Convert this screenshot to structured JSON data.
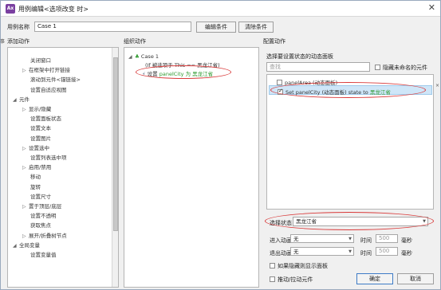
{
  "window": {
    "title": "用例编辑<选项改变 时>",
    "close": "✕",
    "app_icon": "Ax"
  },
  "top": {
    "case_name_label": "用例名称",
    "case_name_value": "Case 1",
    "edit_condition": "编辑条件",
    "clear_condition": "清除条件"
  },
  "columns": {
    "add_action": "添加动作",
    "organize_action": "组织动作",
    "configure_action": "配置动作"
  },
  "actions": [
    {
      "label": "关闭窗口",
      "indent": 2,
      "arrow": ""
    },
    {
      "label": "在框架中打开链接",
      "indent": 1,
      "arrow": "▷"
    },
    {
      "label": "滚动到元件<锚链接>",
      "indent": 2,
      "arrow": ""
    },
    {
      "label": "设置自适应视图",
      "indent": 2,
      "arrow": ""
    },
    {
      "label": "元件",
      "indent": 0,
      "arrow": "◢"
    },
    {
      "label": "显示/隐藏",
      "indent": 1,
      "arrow": "▷"
    },
    {
      "label": "设置面板状态",
      "indent": 2,
      "arrow": ""
    },
    {
      "label": "设置文本",
      "indent": 2,
      "arrow": ""
    },
    {
      "label": "设置图片",
      "indent": 2,
      "arrow": ""
    },
    {
      "label": "设置选中",
      "indent": 1,
      "arrow": "▷"
    },
    {
      "label": "设置列表选中项",
      "indent": 2,
      "arrow": ""
    },
    {
      "label": "启用/禁用",
      "indent": 1,
      "arrow": "▷"
    },
    {
      "label": "移动",
      "indent": 2,
      "arrow": ""
    },
    {
      "label": "旋转",
      "indent": 2,
      "arrow": ""
    },
    {
      "label": "设置尺寸",
      "indent": 2,
      "arrow": ""
    },
    {
      "label": "置于顶层/底层",
      "indent": 1,
      "arrow": "▷"
    },
    {
      "label": "设置不透明",
      "indent": 2,
      "arrow": ""
    },
    {
      "label": "获取焦点",
      "indent": 2,
      "arrow": ""
    },
    {
      "label": "展开/折叠树节点",
      "indent": 1,
      "arrow": "▷"
    },
    {
      "label": "全局变量",
      "indent": 0,
      "arrow": "◢"
    },
    {
      "label": "设置变量值",
      "indent": 2,
      "arrow": ""
    }
  ],
  "organize": {
    "case_label": "Case 1",
    "condition": "(If 被选项于 This == 黑龙江省)",
    "action_prefix": "设置",
    "action_target": "panelCity",
    "action_mid": "为",
    "action_value": "黑龙江省"
  },
  "configure": {
    "select_panel_label": "选择要设置状态的动态面板",
    "search_placeholder": "查找",
    "hide_unnamed": "隐藏未命名的元件",
    "panels": [
      {
        "name": "panelArea (动态面板)",
        "checked": false
      },
      {
        "prefix": "Set panelCity (动态面板) state to",
        "value": "黑龙江省",
        "checked": true
      }
    ],
    "select_state_label": "选择状态",
    "select_state_value": "黑龙江省",
    "enter_anim_label": "进入动画",
    "exit_anim_label": "退出动画",
    "anim_value": "无",
    "time_label": "时间",
    "time_value": "500",
    "ms_label": "毫秒",
    "show_if_hidden": "如果隐藏则显示面板",
    "push_pull": "推动/拉动元件"
  },
  "footer": {
    "ok": "确定",
    "cancel": "取消"
  },
  "edges": {
    "left_char": "事",
    "right_top": "×",
    "right_mid": "S..."
  },
  "colors": {
    "accent_green": "#2f9a2f",
    "annotation_red": "#d93b3b",
    "selection_blue": "#cfe6f8"
  }
}
